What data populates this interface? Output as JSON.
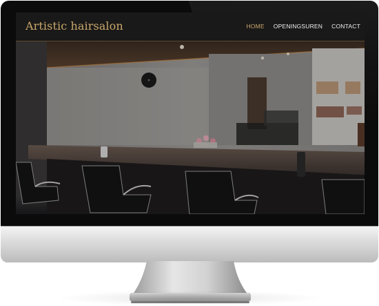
{
  "site": {
    "logo": "Artistic hairsalon",
    "nav": [
      {
        "label": "HOME",
        "active": true
      },
      {
        "label": "OPENINGSUREN",
        "active": false
      },
      {
        "label": "CONTACT",
        "active": false
      }
    ]
  },
  "colors": {
    "accent": "#c9a86a",
    "header_bg": "#1a1919",
    "nav_text": "#f0f0f0"
  },
  "hero": {
    "image": "salon-interior-photo"
  }
}
